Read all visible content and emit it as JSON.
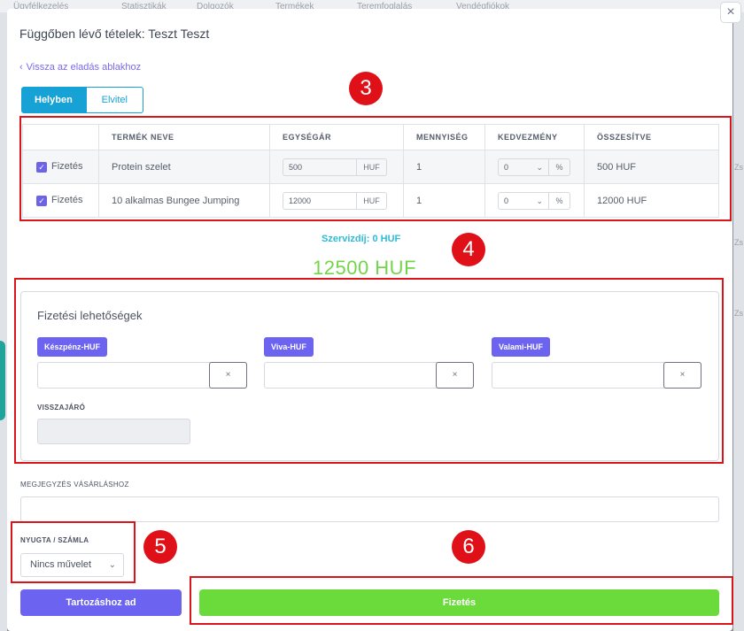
{
  "background": {
    "nav_items": [
      "Ügyfélkezelés",
      "Statisztikák",
      "Dolgozók",
      "Termékek",
      "Teremfoglalás",
      "Vendégfiókok"
    ],
    "side_letters": [
      "Zs",
      "Zs",
      "Zs"
    ]
  },
  "modal": {
    "title": "Függőben lévő tételek: Teszt Teszt",
    "close": "×",
    "back_link": "Vissza az eladás ablakhoz"
  },
  "toggle": {
    "on": "Helyben",
    "off": "Elvitel"
  },
  "table": {
    "headers": [
      "",
      "TERMÉK NEVE",
      "EGYSÉGÁR",
      "MENNYISÉG",
      "KEDVEZMÉNY",
      "ÖSSZESÍTVE"
    ],
    "rows": [
      {
        "check": "Fizetés",
        "name": "Protein szelet",
        "price": "500",
        "currency": "HUF",
        "qty": "1",
        "discount": "0",
        "discount_unit": "%",
        "total": "500 HUF"
      },
      {
        "check": "Fizetés",
        "name": "10 alkalmas Bungee Jumping",
        "price": "12000",
        "currency": "HUF",
        "qty": "1",
        "discount": "0",
        "discount_unit": "%",
        "total": "12000 HUF"
      }
    ]
  },
  "service_fee": "Szervizdíj: 0 HUF",
  "grand_total": "12500 HUF",
  "payment": {
    "title": "Fizetési lehetőségek",
    "methods": [
      {
        "label": "Készpénz-HUF",
        "clear": "×"
      },
      {
        "label": "Viva-HUF",
        "clear": "×"
      },
      {
        "label": "Valami-HUF",
        "clear": "×"
      }
    ],
    "change_label": "VISSZAJÁRÓ"
  },
  "note_label": "MEGJEGYZÉS VÁSÁRLÁSHOZ",
  "receipt": {
    "label": "NYUGTA / SZÁMLA",
    "selected": "Nincs művelet"
  },
  "buttons": {
    "debt": "Tartozáshoz ad",
    "pay": "Fizetés"
  },
  "annotations": [
    "3",
    "4",
    "5",
    "6"
  ],
  "colors": {
    "accent": "#6c63f0",
    "toggle": "#17a2d6",
    "success": "#6bdb3c",
    "service": "#2bbcd8",
    "highlight": "#d9141b"
  }
}
